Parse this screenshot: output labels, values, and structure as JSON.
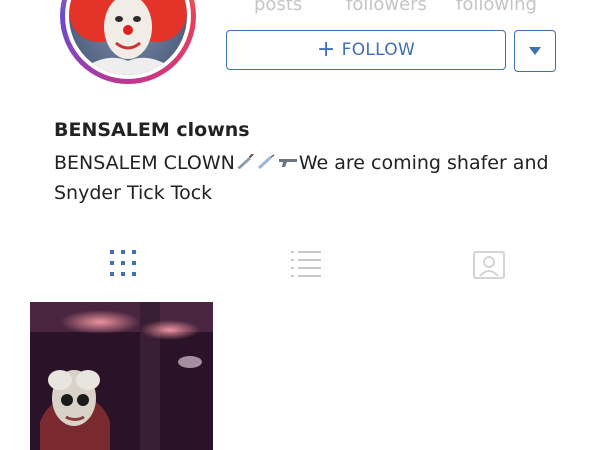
{
  "stats": {
    "posts_label": "posts",
    "followers_label": "followers",
    "following_label": "following"
  },
  "actions": {
    "follow_label": "FOLLOW",
    "follow_icon": "plus-icon",
    "dropdown_icon": "caret-down-icon"
  },
  "profile": {
    "name": "BENSALEM clowns",
    "bio_prefix": "BENSALEM CLOWN",
    "bio_emojis": "knife-icon syringe-icon gun-icon",
    "bio_rest": "We are coming shafer and Snyder Tick Tock"
  },
  "tabs": [
    {
      "icon": "grid-icon",
      "active": true
    },
    {
      "icon": "list-icon",
      "active": false
    },
    {
      "icon": "tagged-photos-icon",
      "active": false
    }
  ],
  "colors": {
    "accent": "#3f6fb4",
    "active_tab": "#3f6fb4",
    "inactive_tab": "#c8c8c8"
  }
}
